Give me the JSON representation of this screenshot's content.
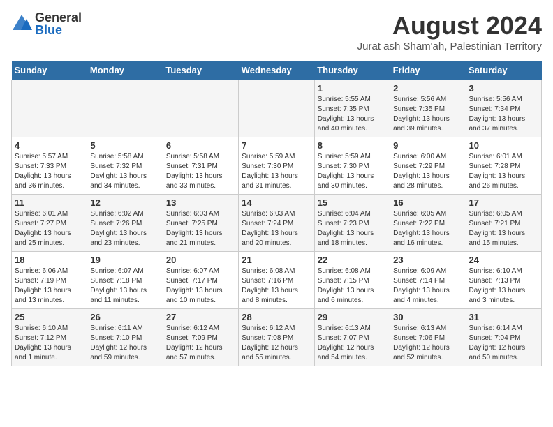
{
  "logo": {
    "general": "General",
    "blue": "Blue"
  },
  "header": {
    "month": "August 2024",
    "location": "Jurat ash Sham'ah, Palestinian Territory"
  },
  "weekdays": [
    "Sunday",
    "Monday",
    "Tuesday",
    "Wednesday",
    "Thursday",
    "Friday",
    "Saturday"
  ],
  "weeks": [
    [
      {
        "day": "",
        "info": ""
      },
      {
        "day": "",
        "info": ""
      },
      {
        "day": "",
        "info": ""
      },
      {
        "day": "",
        "info": ""
      },
      {
        "day": "1",
        "info": "Sunrise: 5:55 AM\nSunset: 7:35 PM\nDaylight: 13 hours\nand 40 minutes."
      },
      {
        "day": "2",
        "info": "Sunrise: 5:56 AM\nSunset: 7:35 PM\nDaylight: 13 hours\nand 39 minutes."
      },
      {
        "day": "3",
        "info": "Sunrise: 5:56 AM\nSunset: 7:34 PM\nDaylight: 13 hours\nand 37 minutes."
      }
    ],
    [
      {
        "day": "4",
        "info": "Sunrise: 5:57 AM\nSunset: 7:33 PM\nDaylight: 13 hours\nand 36 minutes."
      },
      {
        "day": "5",
        "info": "Sunrise: 5:58 AM\nSunset: 7:32 PM\nDaylight: 13 hours\nand 34 minutes."
      },
      {
        "day": "6",
        "info": "Sunrise: 5:58 AM\nSunset: 7:31 PM\nDaylight: 13 hours\nand 33 minutes."
      },
      {
        "day": "7",
        "info": "Sunrise: 5:59 AM\nSunset: 7:30 PM\nDaylight: 13 hours\nand 31 minutes."
      },
      {
        "day": "8",
        "info": "Sunrise: 5:59 AM\nSunset: 7:30 PM\nDaylight: 13 hours\nand 30 minutes."
      },
      {
        "day": "9",
        "info": "Sunrise: 6:00 AM\nSunset: 7:29 PM\nDaylight: 13 hours\nand 28 minutes."
      },
      {
        "day": "10",
        "info": "Sunrise: 6:01 AM\nSunset: 7:28 PM\nDaylight: 13 hours\nand 26 minutes."
      }
    ],
    [
      {
        "day": "11",
        "info": "Sunrise: 6:01 AM\nSunset: 7:27 PM\nDaylight: 13 hours\nand 25 minutes."
      },
      {
        "day": "12",
        "info": "Sunrise: 6:02 AM\nSunset: 7:26 PM\nDaylight: 13 hours\nand 23 minutes."
      },
      {
        "day": "13",
        "info": "Sunrise: 6:03 AM\nSunset: 7:25 PM\nDaylight: 13 hours\nand 21 minutes."
      },
      {
        "day": "14",
        "info": "Sunrise: 6:03 AM\nSunset: 7:24 PM\nDaylight: 13 hours\nand 20 minutes."
      },
      {
        "day": "15",
        "info": "Sunrise: 6:04 AM\nSunset: 7:23 PM\nDaylight: 13 hours\nand 18 minutes."
      },
      {
        "day": "16",
        "info": "Sunrise: 6:05 AM\nSunset: 7:22 PM\nDaylight: 13 hours\nand 16 minutes."
      },
      {
        "day": "17",
        "info": "Sunrise: 6:05 AM\nSunset: 7:21 PM\nDaylight: 13 hours\nand 15 minutes."
      }
    ],
    [
      {
        "day": "18",
        "info": "Sunrise: 6:06 AM\nSunset: 7:19 PM\nDaylight: 13 hours\nand 13 minutes."
      },
      {
        "day": "19",
        "info": "Sunrise: 6:07 AM\nSunset: 7:18 PM\nDaylight: 13 hours\nand 11 minutes."
      },
      {
        "day": "20",
        "info": "Sunrise: 6:07 AM\nSunset: 7:17 PM\nDaylight: 13 hours\nand 10 minutes."
      },
      {
        "day": "21",
        "info": "Sunrise: 6:08 AM\nSunset: 7:16 PM\nDaylight: 13 hours\nand 8 minutes."
      },
      {
        "day": "22",
        "info": "Sunrise: 6:08 AM\nSunset: 7:15 PM\nDaylight: 13 hours\nand 6 minutes."
      },
      {
        "day": "23",
        "info": "Sunrise: 6:09 AM\nSunset: 7:14 PM\nDaylight: 13 hours\nand 4 minutes."
      },
      {
        "day": "24",
        "info": "Sunrise: 6:10 AM\nSunset: 7:13 PM\nDaylight: 13 hours\nand 3 minutes."
      }
    ],
    [
      {
        "day": "25",
        "info": "Sunrise: 6:10 AM\nSunset: 7:12 PM\nDaylight: 13 hours\nand 1 minute."
      },
      {
        "day": "26",
        "info": "Sunrise: 6:11 AM\nSunset: 7:10 PM\nDaylight: 12 hours\nand 59 minutes."
      },
      {
        "day": "27",
        "info": "Sunrise: 6:12 AM\nSunset: 7:09 PM\nDaylight: 12 hours\nand 57 minutes."
      },
      {
        "day": "28",
        "info": "Sunrise: 6:12 AM\nSunset: 7:08 PM\nDaylight: 12 hours\nand 55 minutes."
      },
      {
        "day": "29",
        "info": "Sunrise: 6:13 AM\nSunset: 7:07 PM\nDaylight: 12 hours\nand 54 minutes."
      },
      {
        "day": "30",
        "info": "Sunrise: 6:13 AM\nSunset: 7:06 PM\nDaylight: 12 hours\nand 52 minutes."
      },
      {
        "day": "31",
        "info": "Sunrise: 6:14 AM\nSunset: 7:04 PM\nDaylight: 12 hours\nand 50 minutes."
      }
    ]
  ]
}
